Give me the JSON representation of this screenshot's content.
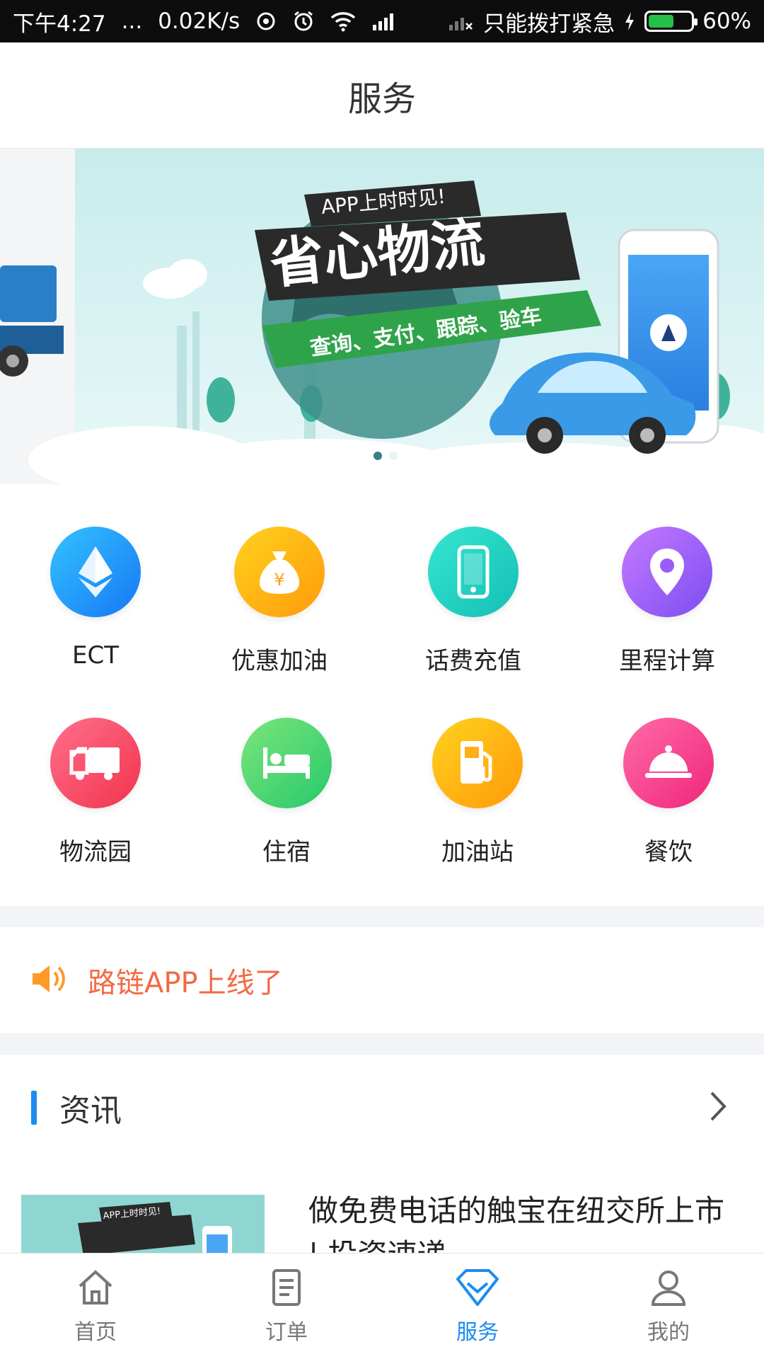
{
  "status_bar": {
    "time": "下午4:27",
    "dots": "...",
    "speed": "0.02K/s",
    "carrier": "只能拨打紧急",
    "battery": "60%",
    "battery_level": 0.6
  },
  "header": {
    "title": "服务"
  },
  "banner": {
    "tagline": "APP上时时见!",
    "headline": "省心物流",
    "subline": "查询、支付、跟踪、验车",
    "active_slide": 1,
    "slide_count": 2
  },
  "services": [
    {
      "label": "ECT",
      "icon": "ethereum-icon",
      "gradient": [
        "#33c3ff",
        "#1677f5"
      ]
    },
    {
      "label": "优惠加油",
      "icon": "money-bag-icon",
      "gradient": [
        "#ffd21f",
        "#ff9a0a"
      ]
    },
    {
      "label": "话费充值",
      "icon": "phone-icon",
      "gradient": [
        "#35e6cf",
        "#14bfb6"
      ]
    },
    {
      "label": "里程计算",
      "icon": "location-pin-icon",
      "gradient": [
        "#c47bff",
        "#7d4cf1"
      ]
    },
    {
      "label": "物流园",
      "icon": "truck-icon",
      "gradient": [
        "#ff6f8c",
        "#f2344d"
      ]
    },
    {
      "label": "住宿",
      "icon": "bed-icon",
      "gradient": [
        "#7de57c",
        "#27c96a"
      ]
    },
    {
      "label": "加油站",
      "icon": "fuel-pump-icon",
      "gradient": [
        "#ffd21f",
        "#ff9a0a"
      ]
    },
    {
      "label": "餐饮",
      "icon": "dining-cloche-icon",
      "gradient": [
        "#ff6ba8",
        "#f0267a"
      ]
    }
  ],
  "notice": {
    "text": "路链APP上线了",
    "icon": "speaker-icon",
    "color": "#f26a45"
  },
  "news": {
    "section_title": "资讯",
    "items": [
      {
        "headline": "做免费电话的触宝在纽交所上市 | 投资速递",
        "thumb_caption": "APP上时时见!"
      }
    ]
  },
  "bottom_nav": {
    "items": [
      {
        "label": "首页",
        "icon": "home-icon",
        "active": false
      },
      {
        "label": "订单",
        "icon": "order-document-icon",
        "active": false
      },
      {
        "label": "服务",
        "icon": "service-diamond-icon",
        "active": true
      },
      {
        "label": "我的",
        "icon": "profile-icon",
        "active": false
      }
    ]
  },
  "colors": {
    "accent": "#1c8cf0",
    "notice": "#f26a45",
    "divider": "#f2f4f7"
  }
}
